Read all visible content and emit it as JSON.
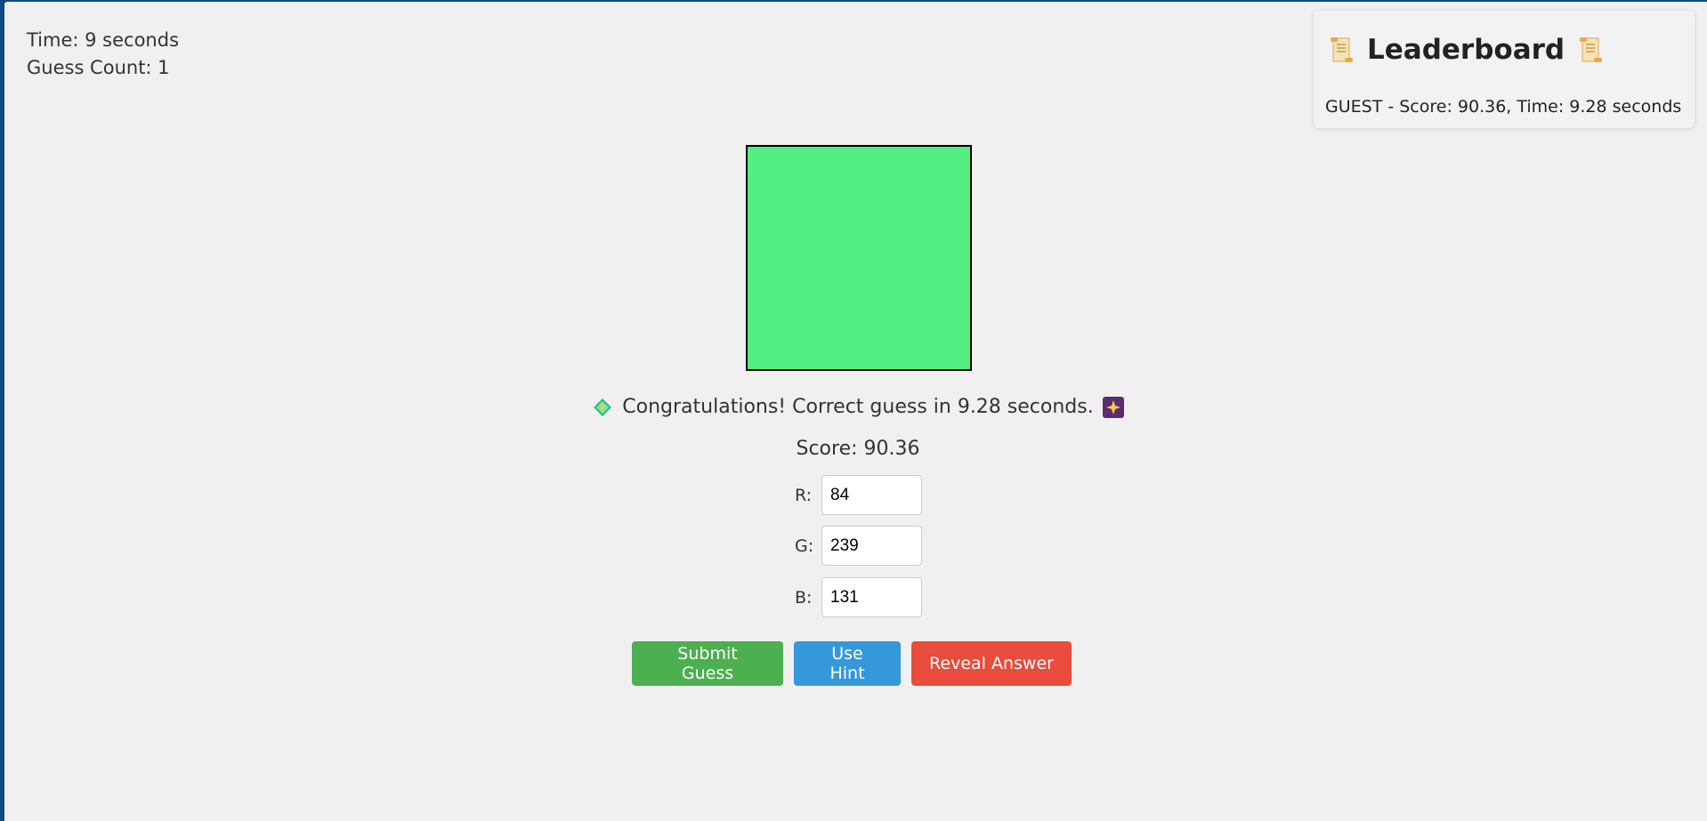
{
  "stats": {
    "time": "Time: 9 seconds",
    "guess_count": "Guess Count: 1"
  },
  "leaderboard": {
    "title": "Leaderboard",
    "icon": "scroll-icon",
    "entries": [
      "GUEST - Score: 90.36, Time: 9.28 seconds"
    ]
  },
  "target_color": "#52ef83",
  "message": {
    "text": "Congratulations! Correct guess in 9.28 seconds.",
    "left_icon": "confetti-icon",
    "right_icon": "sparkle-icon"
  },
  "score": "Score: 90.36",
  "fields": {
    "r_label": "R:",
    "r_value": "84",
    "g_label": "G:",
    "g_value": "239",
    "b_label": "B:",
    "b_value": "131"
  },
  "buttons": {
    "submit": "Submit Guess",
    "hint": "Use Hint",
    "reveal": "Reveal Answer"
  },
  "colors": {
    "submit": "#4caf50",
    "hint": "#3498db",
    "reveal": "#e74c3c",
    "background": "#f0f0f0"
  }
}
